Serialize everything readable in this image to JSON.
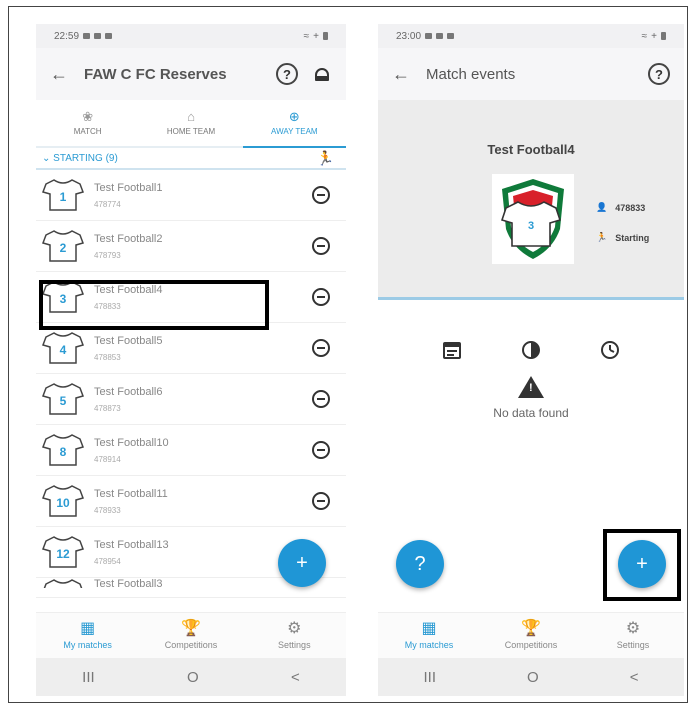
{
  "screen1": {
    "status": {
      "time": "22:59"
    },
    "header": {
      "title": "FAW C FC Reserves",
      "help": "?"
    },
    "tabs": [
      {
        "label": "MATCH",
        "icon": "ball-icon"
      },
      {
        "label": "HOME TEAM",
        "icon": "home-icon"
      },
      {
        "label": "AWAY TEAM",
        "icon": "plus-circle-icon"
      }
    ],
    "section": {
      "label": "STARTING (9)"
    },
    "players": [
      {
        "number": "1",
        "name": "Test Football1",
        "id": "478774"
      },
      {
        "number": "2",
        "name": "Test Football2",
        "id": "478793"
      },
      {
        "number": "3",
        "name": "Test Football4",
        "id": "478833"
      },
      {
        "number": "4",
        "name": "Test Football5",
        "id": "478853"
      },
      {
        "number": "5",
        "name": "Test Football6",
        "id": "478873"
      },
      {
        "number": "8",
        "name": "Test Football10",
        "id": "478914"
      },
      {
        "number": "10",
        "name": "Test Football11",
        "id": "478933"
      },
      {
        "number": "12",
        "name": "Test Football13",
        "id": "478954"
      },
      {
        "number": "",
        "name": "Test Football3",
        "id": ""
      }
    ],
    "fab": "+",
    "nav": [
      {
        "label": "My matches",
        "icon": "grid-icon"
      },
      {
        "label": "Competitions",
        "icon": "trophy-icon"
      },
      {
        "label": "Settings",
        "icon": "gear-icon"
      }
    ]
  },
  "screen2": {
    "status": {
      "time": "23:00"
    },
    "header": {
      "title": "Match events",
      "help": "?"
    },
    "player": {
      "name": "Test Football4",
      "id": "478833",
      "status": "Starting",
      "number": "3"
    },
    "empty": {
      "message": "No data found"
    },
    "help_fab": "?",
    "fab": "+",
    "nav": [
      {
        "label": "My matches",
        "icon": "grid-icon"
      },
      {
        "label": "Competitions",
        "icon": "trophy-icon"
      },
      {
        "label": "Settings",
        "icon": "gear-icon"
      }
    ]
  },
  "colors": {
    "accent": "#2b9bd3",
    "fab": "#1f96d6",
    "highlight": "#000000"
  },
  "sysnav": {
    "recent": "III",
    "home": "O",
    "back": "<"
  }
}
